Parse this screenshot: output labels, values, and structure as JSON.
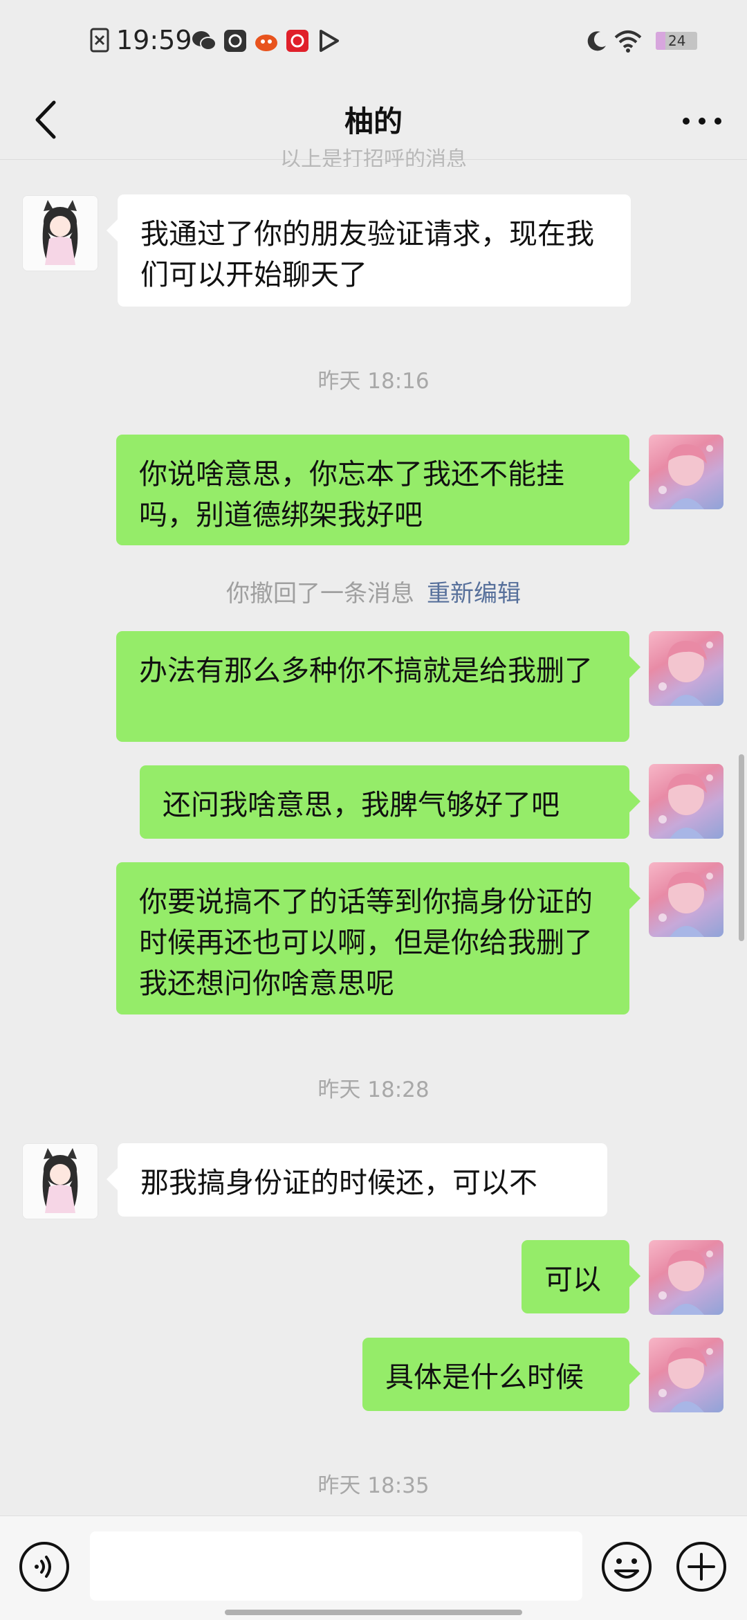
{
  "status_bar": {
    "time": "19:59",
    "battery": "24",
    "left_icons": [
      "sim-icon",
      "wechat-icon",
      "app-icon",
      "app-icon",
      "app-icon",
      "play-icon"
    ],
    "right_icons": [
      "moon-icon",
      "wifi-icon",
      "battery-icon"
    ]
  },
  "header": {
    "title": "柚的",
    "back_icon": "chevron-left-icon",
    "more_icon": "more-icon"
  },
  "chat": {
    "faded_top": "以上是打招呼的消息",
    "timestamps": [
      "昨天 18:16",
      "昨天 18:28",
      "昨天 18:35"
    ],
    "recall_notice": "你撤回了一条消息",
    "recall_edit": "重新编辑",
    "messages": [
      {
        "side": "in",
        "text": "我通过了你的朋友验证请求，现在我们可以开始聊天了"
      },
      {
        "side": "out",
        "text": "你说啥意思，你忘本了我还不能挂吗，别道德绑架我好吧"
      },
      {
        "side": "out",
        "text": "办法有那么多种你不搞就是给我删了"
      },
      {
        "side": "out",
        "text": "还问我啥意思，我脾气够好了吧"
      },
      {
        "side": "out",
        "text": "你要说搞不了的话等到你搞身份证的时候再还也可以啊，但是你给我删了我还想问你啥意思呢"
      },
      {
        "side": "in",
        "text": "那我搞身份证的时候还，可以不"
      },
      {
        "side": "out",
        "text": "可以"
      },
      {
        "side": "out",
        "text": "具体是什么时候"
      }
    ]
  },
  "input_bar": {
    "voice_icon": "voice-icon",
    "emoji_icon": "emoji-icon",
    "plus_icon": "plus-icon"
  },
  "colors": {
    "background": "#ededed",
    "outgoing_bubble": "#95ec69",
    "incoming_bubble": "#ffffff",
    "link": "#57709b"
  }
}
